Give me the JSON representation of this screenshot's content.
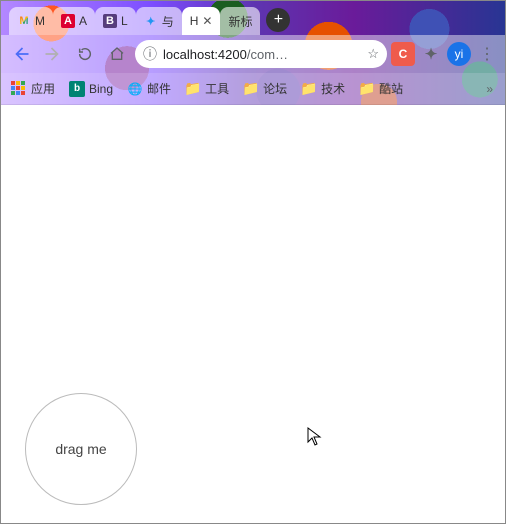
{
  "tabs": [
    {
      "favicon": "gmail",
      "label": "M"
    },
    {
      "favicon": "angular",
      "label": "A"
    },
    {
      "favicon": "bootstrap",
      "label": "L"
    },
    {
      "favicon": "blue",
      "label": "与"
    },
    {
      "favicon": "none",
      "label": "H",
      "active": true
    },
    {
      "favicon": "none",
      "label": "新标"
    }
  ],
  "newtab_plus": "+",
  "toolbar": {
    "url_host": "localhost",
    "url_port": ":4200",
    "url_path": "/com…",
    "avatar_text": "yi"
  },
  "bookmarks": {
    "apps_label": "应用",
    "items": [
      {
        "icon": "bing",
        "label": "Bing"
      },
      {
        "icon": "globe",
        "label": "邮件"
      },
      {
        "icon": "folder",
        "label": "工具"
      },
      {
        "icon": "folder",
        "label": "论坛"
      },
      {
        "icon": "folder",
        "label": "技术"
      },
      {
        "icon": "folder",
        "label": "酷站"
      }
    ],
    "overflow": "»"
  },
  "content": {
    "drag_label": "drag me"
  }
}
